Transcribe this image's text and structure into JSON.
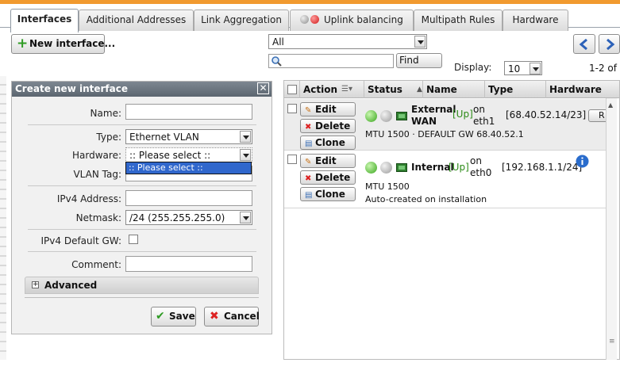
{
  "tabs": [
    {
      "label": "Interfaces"
    },
    {
      "label": "Additional Addresses"
    },
    {
      "label": "Link Aggregation"
    },
    {
      "label": "Uplink balancing"
    },
    {
      "label": "Multipath Rules"
    },
    {
      "label": "Hardware"
    }
  ],
  "toolbar": {
    "new_interface_label": "New interface...",
    "filter_value": "All",
    "search_value": "",
    "find_label": "Find",
    "display_label": "Display:",
    "display_value": "10",
    "paging_text": "1-2 of 2"
  },
  "dialog": {
    "title": "Create new interface",
    "close_symbol": "✕",
    "fields": {
      "name_label": "Name:",
      "name_value": "",
      "type_label": "Type:",
      "type_value": "Ethernet VLAN",
      "hardware_label": "Hardware:",
      "hardware_value": ":: Please select ::",
      "hardware_dropdown_option": ":: Please select ::",
      "vlan_label": "VLAN Tag:",
      "ipv4_label": "IPv4 Address:",
      "ipv4_value": "",
      "netmask_label": "Netmask:",
      "netmask_value": "/24 (255.255.255.0)",
      "gw_label": "IPv4 Default GW:",
      "comment_label": "Comment:",
      "comment_value": ""
    },
    "advanced_label": "Advanced",
    "save_label": "Save",
    "cancel_label": "Cancel"
  },
  "grid": {
    "columns": [
      "Action",
      "Status",
      "Name",
      "Type",
      "Hardware"
    ],
    "row_buttons": {
      "edit": "Edit",
      "delete": "Delete",
      "clone": "Clone",
      "cut": "R"
    },
    "rows": [
      {
        "name": "External WAN",
        "status": "[Up]",
        "on": "on eth1",
        "type": "[68.40.52.14/23]",
        "detail": "MTU 1500 · DEFAULT GW 68.40.52.1"
      },
      {
        "name": "Internal",
        "status": "[Up]",
        "on": "on eth0",
        "type": "[192.168.1.1/24]",
        "detail1": "MTU 1500",
        "detail2": "Auto-created on installation"
      }
    ]
  },
  "colors": {
    "accent_orange": "#f19a2f",
    "header_bg": "#6b757f",
    "selection_blue": "#3067cc",
    "status_green": "#2b8a16"
  },
  "icons": [
    "plus-icon",
    "search-icon",
    "prev-icon",
    "next-icon",
    "close-icon",
    "check-icon",
    "x-icon",
    "edit-icon",
    "delete-icon",
    "clone-icon",
    "nic-icon",
    "info-icon"
  ]
}
